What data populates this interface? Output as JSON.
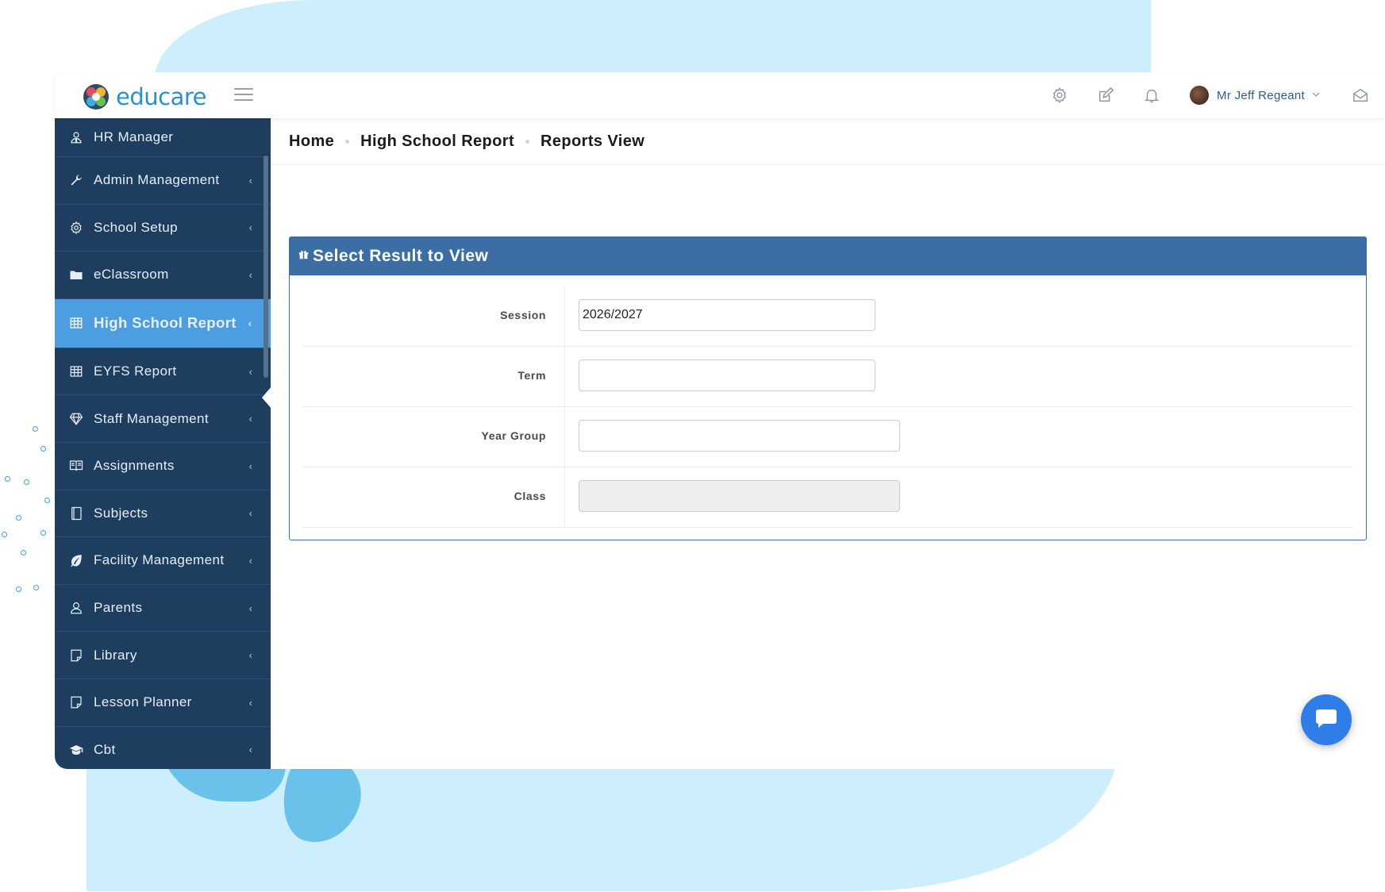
{
  "brand": {
    "name": "educare"
  },
  "user": {
    "name": "Mr Jeff Regeant"
  },
  "sidebar": {
    "items": [
      {
        "label": "HR Manager",
        "icon": "user-tie-icon",
        "arrow": ""
      },
      {
        "label": "Admin Management",
        "icon": "wrench-icon",
        "arrow": "‹"
      },
      {
        "label": "School Setup",
        "icon": "gear-icon",
        "arrow": "‹"
      },
      {
        "label": "eClassroom",
        "icon": "folder-icon",
        "arrow": "‹"
      },
      {
        "label": "High School Report",
        "icon": "table-icon",
        "arrow": "‹",
        "active": true
      },
      {
        "label": "EYFS Report",
        "icon": "table-icon",
        "arrow": "‹"
      },
      {
        "label": "Staff Management",
        "icon": "diamond-icon",
        "arrow": "‹"
      },
      {
        "label": "Assignments",
        "icon": "book-icon",
        "arrow": "‹"
      },
      {
        "label": "Subjects",
        "icon": "notebook-icon",
        "arrow": "‹"
      },
      {
        "label": "Facility Management",
        "icon": "leaf-icon",
        "arrow": "‹"
      },
      {
        "label": "Parents",
        "icon": "user-icon",
        "arrow": "‹"
      },
      {
        "label": "Library",
        "icon": "note-icon",
        "arrow": "‹"
      },
      {
        "label": "Lesson Planner",
        "icon": "note-icon",
        "arrow": "‹"
      },
      {
        "label": "Cbt",
        "icon": "graduation-cap-icon",
        "arrow": "‹"
      }
    ]
  },
  "breadcrumb": {
    "items": [
      "Home",
      "High School Report",
      "Reports View"
    ]
  },
  "panel": {
    "title": "Select Result to View",
    "fields": [
      {
        "label": "Session",
        "value": "2026/2027",
        "disabled": false
      },
      {
        "label": "Term",
        "value": "",
        "disabled": false
      },
      {
        "label": "Year Group",
        "value": "",
        "disabled": false
      },
      {
        "label": "Class",
        "value": "",
        "disabled": true
      }
    ]
  },
  "colors": {
    "sidebar_bg": "#1e3e5f",
    "sidebar_active": "#4d9ee0",
    "panel_header": "#3b6ea5",
    "brand": "#2b8fd8",
    "chat_button": "#2f7de8",
    "backdrop": "#cdeefc"
  }
}
